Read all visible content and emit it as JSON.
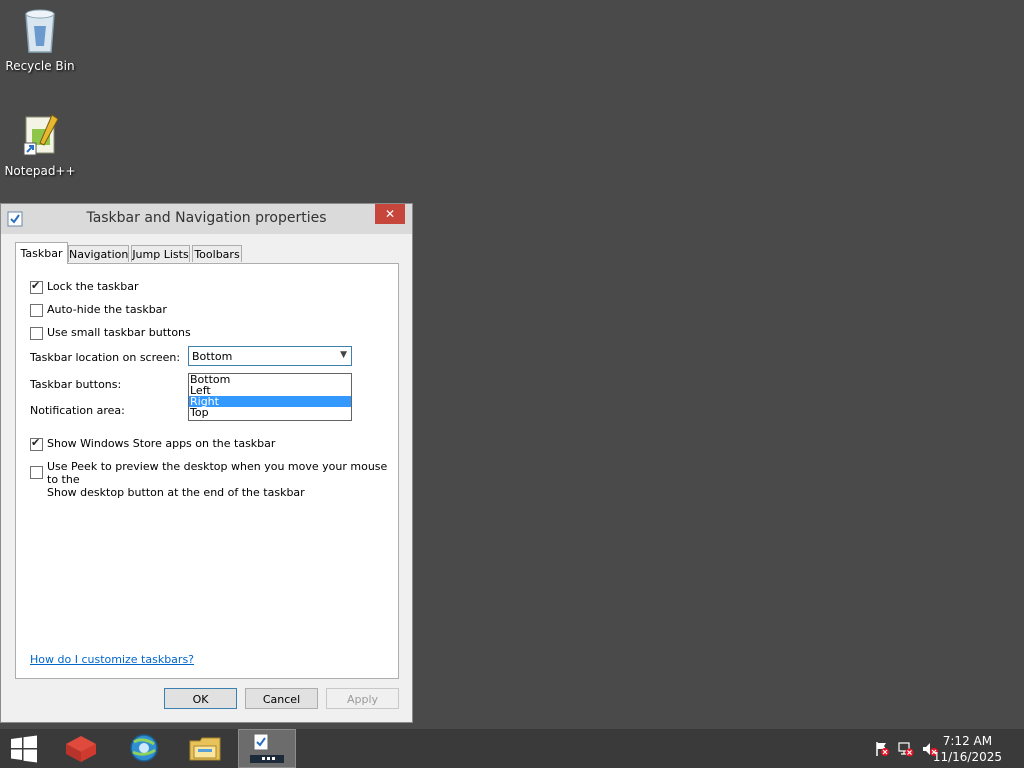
{
  "desktop": {
    "icons": [
      {
        "label": "Recycle Bin",
        "icon": "recycle-bin-icon"
      },
      {
        "label": "Notepad++",
        "icon": "notepad-plus-plus-icon"
      }
    ]
  },
  "dialog": {
    "title": "Taskbar and Navigation properties",
    "close_label": "✕",
    "tabs": [
      {
        "label": "Taskbar",
        "active": true
      },
      {
        "label": "Navigation",
        "active": false
      },
      {
        "label": "Jump Lists",
        "active": false
      },
      {
        "label": "Toolbars",
        "active": false
      }
    ],
    "options": {
      "lock_taskbar": {
        "label": "Lock the taskbar",
        "checked": true
      },
      "auto_hide": {
        "label": "Auto-hide the taskbar",
        "checked": false
      },
      "small_buttons": {
        "label": "Use small taskbar buttons",
        "checked": false
      },
      "store_apps": {
        "label": "Show Windows Store apps on the taskbar",
        "checked": true
      },
      "peek": {
        "label_line1": "Use Peek to preview the desktop when you move your mouse to the",
        "label_line2": "Show desktop button at the end of the taskbar",
        "checked": false
      }
    },
    "location": {
      "label": "Taskbar location on screen:",
      "value": "Bottom",
      "options": [
        "Bottom",
        "Left",
        "Right",
        "Top"
      ],
      "highlighted": "Right"
    },
    "buttons_label": "Taskbar buttons:",
    "notification_label": "Notification area:",
    "help_link": "How do I customize taskbars?",
    "ok": "OK",
    "cancel": "Cancel",
    "apply": "Apply"
  },
  "taskbar": {
    "items": [
      "start-icon",
      "cube-app-icon",
      "browser-icon",
      "file-explorer-icon",
      "taskbar-properties-icon"
    ],
    "clock_time": "7:12 AM",
    "clock_date": "11/16/2025"
  },
  "colors": {
    "desktop": "#4a4a4a",
    "close_button": "#c7463b",
    "selection": "#3399ff",
    "link": "#0066cc"
  }
}
